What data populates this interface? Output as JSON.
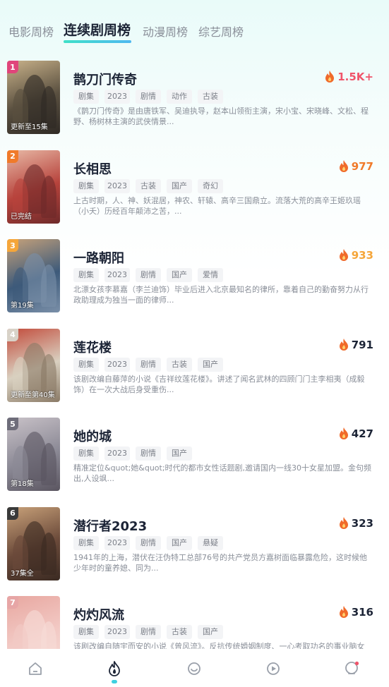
{
  "tabs": [
    {
      "label": "电影周榜",
      "active": false
    },
    {
      "label": "连续剧周榜",
      "active": true
    },
    {
      "label": "动漫周榜",
      "active": false
    },
    {
      "label": "综艺周榜",
      "active": false
    }
  ],
  "items": [
    {
      "rank": "1",
      "rank_color": "#e0457b",
      "status": "更新至15集",
      "title": "鹊刀门传奇",
      "heat": "1.5K+",
      "heat_color": "#f0546a",
      "tags": [
        "剧集",
        "2023",
        "剧情",
        "动作",
        "古装"
      ],
      "desc": "《鹊刀门传奇》是由唐铁军、吴迪执导，赵本山领衔主演，宋小宝、宋晓峰、文松、程野、杨树林主演的武侠情景...",
      "poster_colors": [
        "#5a5040",
        "#c9b28a",
        "#2f2a25"
      ]
    },
    {
      "rank": "2",
      "rank_color": "#f07a2a",
      "status": "已完结",
      "title": "长相思",
      "heat": "977",
      "heat_color": "#f07a2a",
      "tags": [
        "剧集",
        "2023",
        "古装",
        "国产",
        "奇幻"
      ],
      "desc": "上古时期，人、神、妖混居，神农、轩辕、高辛三国鼎立。流落大荒的高辛王姬玖瑶（小夭）历经百年颠沛之苦，...",
      "poster_colors": [
        "#b7433c",
        "#e8b9a6",
        "#6e2a2a"
      ]
    },
    {
      "rank": "3",
      "rank_color": "#f5a63a",
      "status": "第19集",
      "title": "一路朝阳",
      "heat": "933",
      "heat_color": "#f5a63a",
      "tags": [
        "剧集",
        "2023",
        "剧情",
        "国产",
        "爱情"
      ],
      "desc": "北漂女孩李慕嘉（李兰迪饰）毕业后进入北京最知名的律所，靠着自己的勤奋努力从行政助理成为独当一面的律师...",
      "poster_colors": [
        "#3d5a7a",
        "#c7a27a",
        "#7a8fa8"
      ]
    },
    {
      "rank": "4",
      "rank_color": "#d8d2c8",
      "status": "更新至第40集",
      "title": "莲花楼",
      "heat": "791",
      "heat_color": "#1c2436",
      "tags": [
        "剧集",
        "2023",
        "剧情",
        "古装",
        "国产"
      ],
      "desc": "该剧改编自藤萍的小说《吉祥纹莲花楼》。讲述了闻名武林的四顾门门主李相夷（成毅饰）在一次大战后身受重伤...",
      "poster_colors": [
        "#d9d0c0",
        "#c24a3a",
        "#8a7a66"
      ]
    },
    {
      "rank": "5",
      "rank_color": "#6e6d7a",
      "status": "第18集",
      "title": "她的城",
      "heat": "427",
      "heat_color": "#1c2436",
      "tags": [
        "剧集",
        "2023",
        "剧情",
        "国产"
      ],
      "desc": "精准定位&quot;她&quot;时代的都市女性话题剧,邀请国内一线30十女星加盟。金句频出,人设飒...",
      "poster_colors": [
        "#8c8a96",
        "#c9c2c8",
        "#5a5560"
      ]
    },
    {
      "rank": "6",
      "rank_color": "#3a3a3a",
      "status": "37集全",
      "title": "潜行者2023",
      "heat": "323",
      "heat_color": "#1c2436",
      "tags": [
        "剧集",
        "2023",
        "剧情",
        "国产",
        "悬疑"
      ],
      "desc": "1941年的上海，潜伏在汪伪特工总部76号的共产党员方嘉树面临暴露危险，这时候他少年时的童养媳、同为...",
      "poster_colors": [
        "#6b4a3a",
        "#c9a27a",
        "#3a2a22"
      ]
    },
    {
      "rank": "7",
      "rank_color": "#e7a6a6",
      "status": "",
      "title": "灼灼风流",
      "heat": "316",
      "heat_color": "#1c2436",
      "tags": [
        "剧集",
        "2023",
        "剧情",
        "古装",
        "国产"
      ],
      "desc": "该剧改编自随宇而安的小说《曾风流》。反抗传统婚姻制度、一心考取功名的事业脑女",
      "poster_colors": [
        "#f2c9c4",
        "#e8a7a0",
        "#f6dcd7"
      ]
    }
  ],
  "nav": [
    {
      "icon": "home-icon",
      "active": false
    },
    {
      "icon": "flame-icon",
      "active": true
    },
    {
      "icon": "chat-icon",
      "active": false
    },
    {
      "icon": "play-icon",
      "active": false
    },
    {
      "icon": "profile-icon",
      "active": false,
      "badge": true
    }
  ],
  "colors": {
    "accent": "#3fd0e0",
    "badge": "#f0546a"
  }
}
